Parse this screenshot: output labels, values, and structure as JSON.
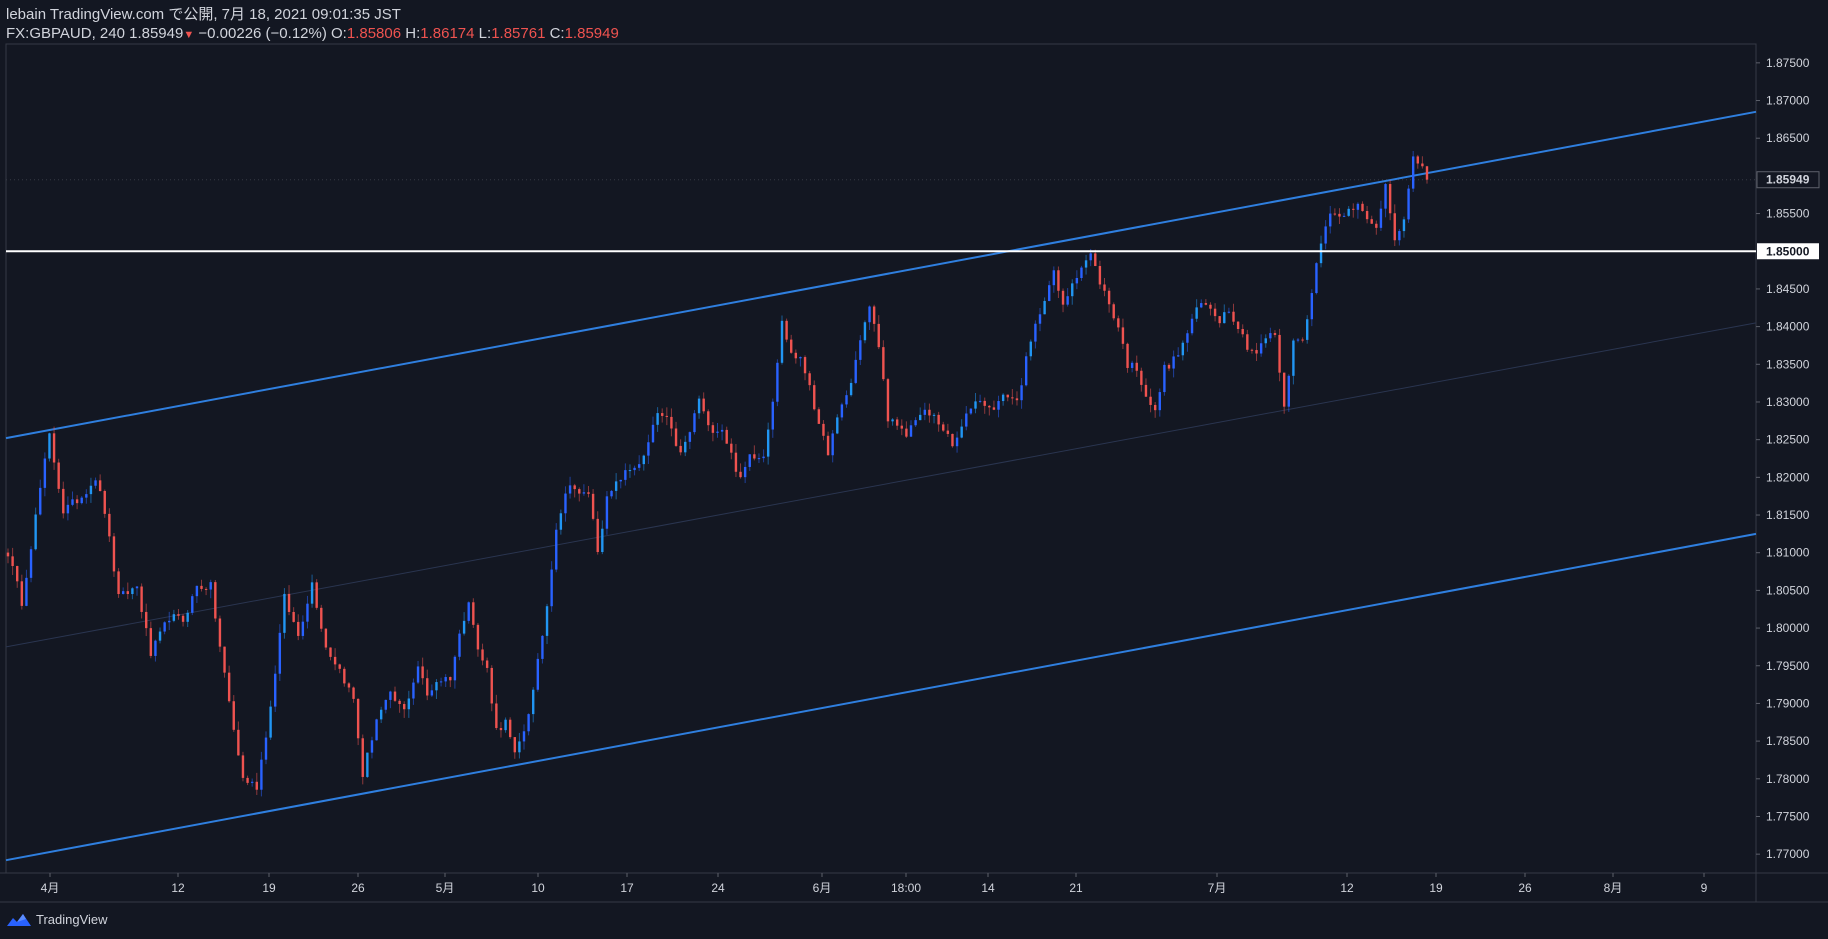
{
  "header": {
    "publisher": "lebain TradingView.com で公開, 7月 18, 2021 09:01:35 JST",
    "symbol": "FX:GBPAUD, 240",
    "last": "1.85949",
    "change_arrow": "▼",
    "change": "−0.00226 (−0.12%)",
    "o_label": "O:",
    "o": "1.85806",
    "h_label": "H:",
    "h": "1.86174",
    "l_label": "L:",
    "l": "1.85761",
    "c_label": "C:",
    "c": "1.85949"
  },
  "footer": {
    "brand": "TradingView",
    "logo_icon": "tradingview-logo-icon"
  },
  "colors": {
    "background": "#131722",
    "up": "#2962ff",
    "up_light": "#2196f3",
    "down": "#ef5350",
    "channel": "#2f7fdf",
    "level": "#ffffff",
    "axis_text": "#d1d4dc",
    "grid": "#2a2e39"
  },
  "chart_data": {
    "type": "candlestick",
    "symbol": "FX:GBPAUD",
    "interval": "240",
    "ylim": [
      1.7675,
      1.8775
    ],
    "y_ticks": [
      "1.87500",
      "1.87000",
      "1.86500",
      "1.85949",
      "1.85500",
      "1.85000",
      "1.84500",
      "1.84000",
      "1.83500",
      "1.83000",
      "1.82500",
      "1.82000",
      "1.81500",
      "1.81000",
      "1.80500",
      "1.80000",
      "1.79500",
      "1.79000",
      "1.78500",
      "1.78000",
      "1.77500",
      "1.77000"
    ],
    "price_labels": {
      "current": "1.85949",
      "level": "1.85000"
    },
    "x_ticks": [
      "4月",
      "12",
      "19",
      "26",
      "5月",
      "10",
      "17",
      "24",
      "6月",
      "18:00",
      "14",
      "21",
      "7月",
      "12",
      "19",
      "26",
      "8月",
      "9"
    ],
    "horizontal_level": 1.85,
    "channel": {
      "upper": {
        "start": 1.8252,
        "end": 1.8685
      },
      "middle": {
        "start": 1.7975,
        "end": 1.8405
      },
      "lower": {
        "start": 1.7692,
        "end": 1.8125
      }
    },
    "close_path": [
      [
        0,
        1.81
      ],
      [
        3,
        1.8035
      ],
      [
        7,
        1.8185
      ],
      [
        9,
        1.8255
      ],
      [
        12,
        1.8155
      ],
      [
        16,
        1.8175
      ],
      [
        19,
        1.82
      ],
      [
        21,
        1.8155
      ],
      [
        24,
        1.804
      ],
      [
        28,
        1.8055
      ],
      [
        31,
        1.7965
      ],
      [
        35,
        1.8015
      ],
      [
        38,
        1.801
      ],
      [
        41,
        1.8055
      ],
      [
        44,
        1.8055
      ],
      [
        46,
        1.7975
      ],
      [
        49,
        1.7865
      ],
      [
        51,
        1.78
      ],
      [
        54,
        1.779
      ],
      [
        57,
        1.7895
      ],
      [
        60,
        1.804
      ],
      [
        63,
        1.799
      ],
      [
        66,
        1.806
      ],
      [
        69,
        1.7975
      ],
      [
        72,
        1.7945
      ],
      [
        75,
        1.7905
      ],
      [
        77,
        1.7805
      ],
      [
        80,
        1.788
      ],
      [
        83,
        1.791
      ],
      [
        86,
        1.789
      ],
      [
        89,
        1.795
      ],
      [
        91,
        1.791
      ],
      [
        93,
        1.793
      ],
      [
        96,
        1.7935
      ],
      [
        98,
        1.799
      ],
      [
        100,
        1.804
      ],
      [
        102,
        1.797
      ],
      [
        104,
        1.7945
      ],
      [
        106,
        1.7865
      ],
      [
        108,
        1.7875
      ],
      [
        110,
        1.783
      ],
      [
        112,
        1.7865
      ],
      [
        114,
        1.7915
      ],
      [
        117,
        1.803
      ],
      [
        119,
        1.8135
      ],
      [
        122,
        1.8195
      ],
      [
        124,
        1.8175
      ],
      [
        126,
        1.818
      ],
      [
        128,
        1.8105
      ],
      [
        130,
        1.817
      ],
      [
        133,
        1.82
      ],
      [
        136,
        1.8215
      ],
      [
        138,
        1.8225
      ],
      [
        141,
        1.8285
      ],
      [
        143,
        1.8275
      ],
      [
        146,
        1.823
      ],
      [
        148,
        1.826
      ],
      [
        150,
        1.8305
      ],
      [
        152,
        1.8265
      ],
      [
        155,
        1.8265
      ],
      [
        157,
        1.823
      ],
      [
        159,
        1.8195
      ],
      [
        161,
        1.823
      ],
      [
        164,
        1.823
      ],
      [
        166,
        1.8305
      ],
      [
        168,
        1.8405
      ],
      [
        170,
        1.8365
      ],
      [
        172,
        1.8355
      ],
      [
        174,
        1.8325
      ],
      [
        176,
        1.8265
      ],
      [
        178,
        1.8235
      ],
      [
        181,
        1.8295
      ],
      [
        183,
        1.8325
      ],
      [
        185,
        1.8385
      ],
      [
        187,
        1.8425
      ],
      [
        189,
        1.8375
      ],
      [
        191,
        1.828
      ],
      [
        193,
        1.8265
      ],
      [
        195,
        1.8255
      ],
      [
        197,
        1.828
      ],
      [
        199,
        1.8285
      ],
      [
        201,
        1.828
      ],
      [
        203,
        1.8265
      ],
      [
        205,
        1.824
      ],
      [
        207,
        1.8265
      ],
      [
        209,
        1.8295
      ],
      [
        211,
        1.8305
      ],
      [
        213,
        1.829
      ],
      [
        215,
        1.83
      ],
      [
        217,
        1.831
      ],
      [
        219,
        1.83
      ],
      [
        221,
        1.8355
      ],
      [
        223,
        1.84
      ],
      [
        225,
        1.844
      ],
      [
        227,
        1.847
      ],
      [
        229,
        1.8425
      ],
      [
        231,
        1.846
      ],
      [
        233,
        1.848
      ],
      [
        235,
        1.8495
      ],
      [
        237,
        1.846
      ],
      [
        239,
        1.843
      ],
      [
        241,
        1.84
      ],
      [
        243,
        1.835
      ],
      [
        245,
        1.8345
      ],
      [
        247,
        1.831
      ],
      [
        249,
        1.8285
      ],
      [
        251,
        1.8345
      ],
      [
        253,
        1.8355
      ],
      [
        255,
        1.8375
      ],
      [
        257,
        1.841
      ],
      [
        259,
        1.843
      ],
      [
        261,
        1.8425
      ],
      [
        263,
        1.841
      ],
      [
        265,
        1.8425
      ],
      [
        267,
        1.84
      ],
      [
        269,
        1.8375
      ],
      [
        271,
        1.8365
      ],
      [
        273,
        1.8385
      ],
      [
        275,
        1.839
      ],
      [
        277,
        1.829
      ],
      [
        279,
        1.8385
      ],
      [
        281,
        1.838
      ],
      [
        283,
        1.845
      ],
      [
        285,
        1.851
      ],
      [
        287,
        1.8555
      ],
      [
        289,
        1.8545
      ],
      [
        291,
        1.856
      ],
      [
        293,
        1.856
      ],
      [
        295,
        1.854
      ],
      [
        297,
        1.853
      ],
      [
        299,
        1.859
      ],
      [
        301,
        1.852
      ],
      [
        303,
        1.854
      ],
      [
        305,
        1.862
      ],
      [
        307,
        1.8615
      ],
      [
        308,
        1.8595
      ]
    ]
  }
}
